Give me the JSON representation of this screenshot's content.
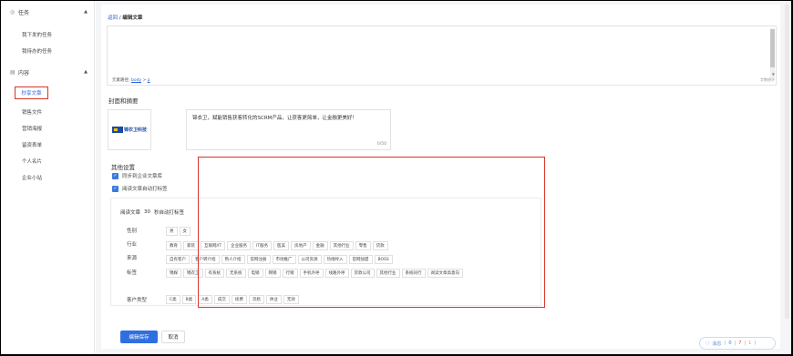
{
  "sidebar": {
    "task_group": {
      "label": "任务",
      "icon": "target-icon"
    },
    "task_items": [
      {
        "label": "我下发的任务"
      },
      {
        "label": "我待办的任务"
      }
    ],
    "content_group": {
      "label": "内容",
      "icon": "content-icon"
    },
    "content_items": [
      {
        "label": "秒享文章",
        "active": true
      },
      {
        "label": "销售文件"
      },
      {
        "label": "营销海报"
      },
      {
        "label": "留资表单"
      },
      {
        "label": "个人名片"
      },
      {
        "label": "企业小站"
      }
    ]
  },
  "breadcrumb": {
    "back": "返回",
    "separator": " / ",
    "current": "编辑文章"
  },
  "editor": {
    "path_label": "元素路径:",
    "path_body": "body",
    "path_sep": " > ",
    "path_p": "p",
    "word_count": "字数统计"
  },
  "cover": {
    "title": "封面和摘要",
    "logo_text": "锦衣卫科技",
    "summary_text": "锦衣卫，赋能销售获客转化的SCRM产品，让获客更简单，让金融更美好！",
    "summary_count": "0/50"
  },
  "other_settings": {
    "title": "其他设置",
    "checkbox_sync": "同步到企业文章库",
    "checkbox_autotag": "阅读文章自动打标签",
    "read_prefix": "阅读文章",
    "read_seconds": "30",
    "read_suffix": "秒自动打标签",
    "rows": {
      "gender": {
        "label": "性别",
        "tags": [
          "男",
          "女"
        ]
      },
      "industry": {
        "label": "行业",
        "tags": [
          "教育",
          "家装",
          "互联网/IT",
          "企业服务",
          "IT服务",
          "医美",
          "房地产",
          "金融",
          "其他行业",
          "零售",
          "贷款"
        ]
      },
      "source": {
        "label": "来源",
        "tags": [
          "自有客户",
          "客户转介绍",
          "熟人介绍",
          "官网注册",
          "市场推广",
          "公司资源",
          "热线呼入",
          "官网加盟",
          "BOSS"
        ]
      },
      "tag": {
        "label": "标签",
        "tags": [
          "锦媒",
          "锦衣卫",
          "有系统",
          "无系统",
          "电销",
          "网销",
          "行销",
          "手机外呼",
          "线路外呼",
          "贷款公司",
          "其他行业",
          "系统同行",
          "阅读文章高意向"
        ]
      },
      "customer_type": {
        "label": "客户类型",
        "tags": [
          "C类",
          "B类",
          "A类",
          "成交",
          "续费",
          "流损",
          "休业",
          "无效"
        ]
      }
    }
  },
  "actions": {
    "save": "编辑保存",
    "cancel": "取消"
  },
  "message_bar": {
    "icon": "chat-icon",
    "label": "消息",
    "count_a": "0",
    "count_b": "7",
    "count_c": "1",
    "open": "(",
    "close": ")",
    "sep": "|"
  },
  "colors": {
    "accent": "#2f6fe0",
    "highlight": "#d9342b",
    "checkbox": "#3a7be0"
  }
}
